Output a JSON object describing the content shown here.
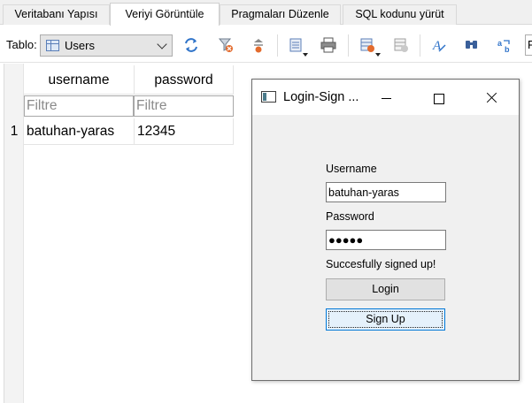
{
  "tabs": [
    {
      "label": "Veritabanı Yapısı"
    },
    {
      "label": "Veriyi Görüntüle"
    },
    {
      "label": "Pragmaları Düzenle"
    },
    {
      "label": "SQL kodunu yürüt"
    }
  ],
  "toolbar": {
    "tablo_label": "Tablo:",
    "table_select_value": "Users",
    "icons": [
      "refresh-icon",
      "clear-filters-icon",
      "save-filter-icon",
      "print-icon",
      "insert-record-icon",
      "delete-record-icon",
      "font-icon",
      "find-icon",
      "replace-icon"
    ]
  },
  "grid": {
    "columns": [
      "username",
      "password"
    ],
    "filter_placeholder": "Filtre",
    "rows": [
      {
        "num": "1",
        "username": "batuhan-yaras",
        "password": "12345"
      }
    ]
  },
  "dialog": {
    "title": "Login-Sign ...",
    "username_label": "Username",
    "username_value": "batuhan-yaras",
    "password_label": "Password",
    "password_value": "●●●●●",
    "status_text": "Succesfully signed up!",
    "login_label": "Login",
    "signup_label": "Sign Up"
  }
}
